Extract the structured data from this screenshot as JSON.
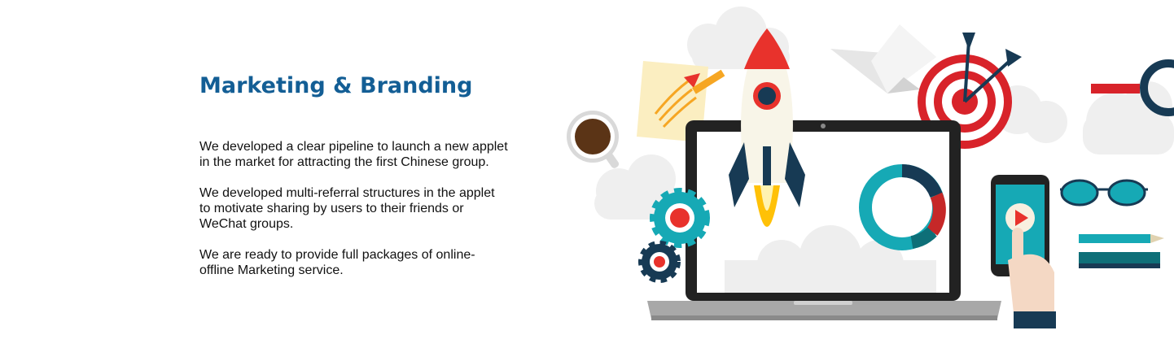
{
  "heading": "Marketing & Branding",
  "paragraphs": [
    "We developed a clear pipeline to launch a new applet in the market for attracting the first Chinese group.",
    "We developed multi-referral structures in the applet to motivate sharing by users to their friends or WeChat groups.",
    "We are ready to provide full packages of online-offline Marketing service."
  ],
  "colors": {
    "heading": "#135e95",
    "body_text": "#111111",
    "rocket_red": "#e8322c",
    "teal": "#16a9b5",
    "navy": "#173a54",
    "laptop_frame": "#222222"
  },
  "illustration_icons": [
    "cloud-icon",
    "sticky-note-icon",
    "coffee-cup-icon",
    "rocket-icon",
    "laptop-icon",
    "paper-plane-icon",
    "target-icon",
    "magnifier-icon",
    "gear-icon",
    "donut-chart-icon",
    "smartphone-icon",
    "play-icon",
    "hand-icon",
    "glasses-icon",
    "pen-icon"
  ]
}
